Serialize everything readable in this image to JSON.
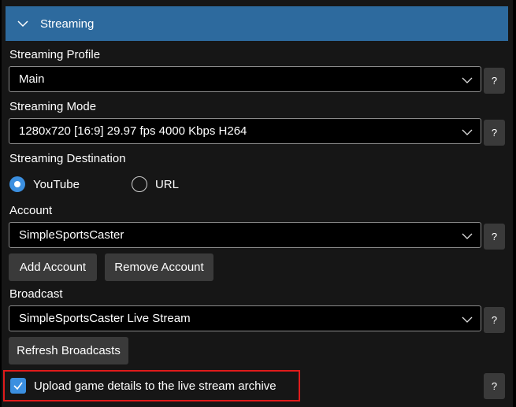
{
  "section": {
    "title": "Streaming"
  },
  "profile": {
    "label": "Streaming Profile",
    "value": "Main"
  },
  "mode": {
    "label": "Streaming Mode",
    "value": "1280x720 [16:9] 29.97 fps 4000 Kbps H264"
  },
  "destination": {
    "label": "Streaming Destination",
    "options": [
      {
        "label": "YouTube",
        "selected": true
      },
      {
        "label": "URL",
        "selected": false
      }
    ]
  },
  "account": {
    "label": "Account",
    "value": "SimpleSportsCaster",
    "add_label": "Add Account",
    "remove_label": "Remove Account"
  },
  "broadcast": {
    "label": "Broadcast",
    "value": "SimpleSportsCaster Live Stream",
    "refresh_label": "Refresh Broadcasts"
  },
  "upload": {
    "label": "Upload game details to the live stream archive",
    "checked": true
  },
  "help": {
    "label": "?"
  },
  "colors": {
    "accent": "#3b8fe0",
    "header": "#2d6a9e",
    "highlight": "#e01b1b"
  }
}
